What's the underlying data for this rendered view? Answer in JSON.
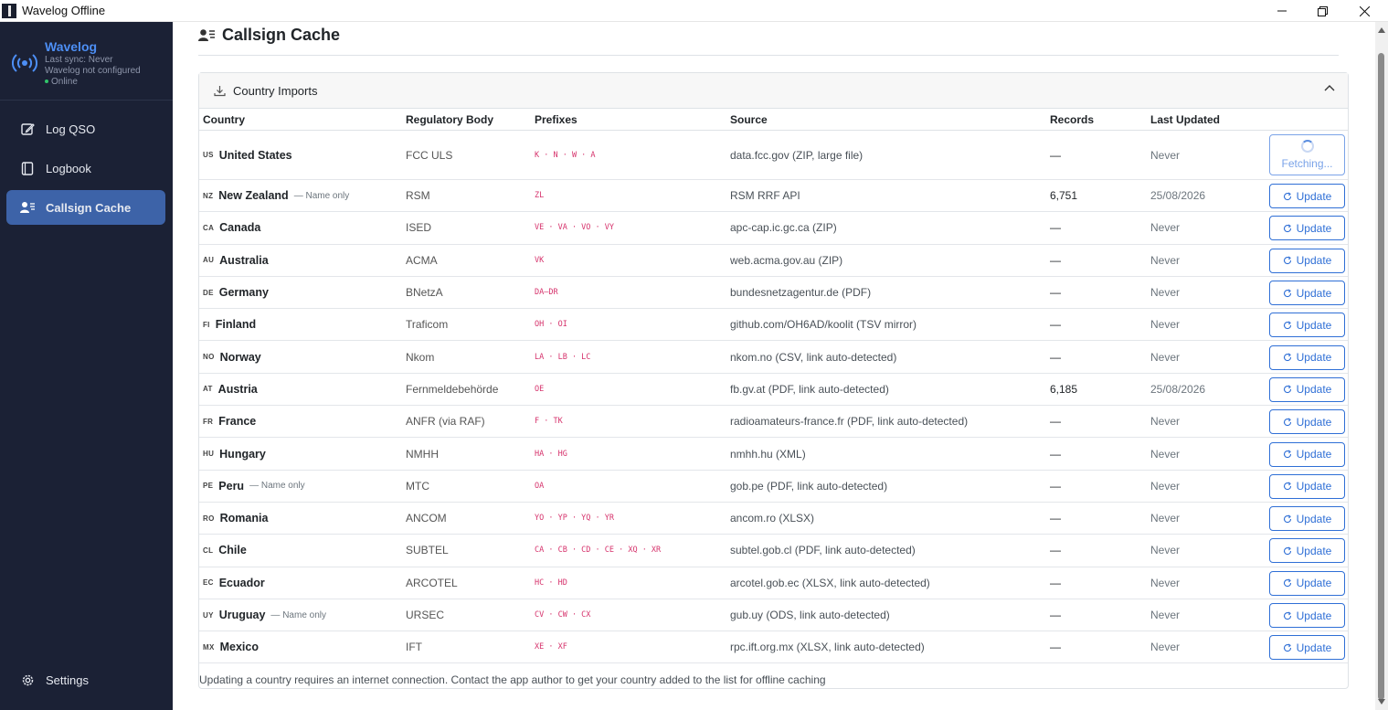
{
  "window": {
    "title": "Wavelog Offline",
    "minimize_icon": "minimize-icon",
    "restore_icon": "restore-icon",
    "close_icon": "close-icon"
  },
  "sidebar": {
    "brand_name": "Wavelog",
    "last_sync": "Last sync: Never",
    "config_status": "Wavelog not configured",
    "online_status": "Online",
    "items": [
      {
        "label": "Log QSO",
        "icon": "edit-icon"
      },
      {
        "label": "Logbook",
        "icon": "book-icon"
      },
      {
        "label": "Callsign Cache",
        "icon": "user-list-icon",
        "active": true
      }
    ],
    "settings_label": "Settings",
    "colors": {
      "background": "#1b2135",
      "brand": "#4d8ff5",
      "active": "#3d63a8",
      "online_dot": "#31c46a"
    }
  },
  "page": {
    "title": "Callsign Cache"
  },
  "card": {
    "header": "Country Imports",
    "columns": [
      "Country",
      "Regulatory Body",
      "Prefixes",
      "Source",
      "Records",
      "Last Updated"
    ],
    "update_label": "Update",
    "fetching_label": "Fetching...",
    "rows": [
      {
        "code": "US",
        "country": "United States",
        "note": "",
        "regulator": "FCC ULS",
        "prefixes": "K · N · W · A",
        "source": "data.fcc.gov (ZIP, large file)",
        "records": "—",
        "updated": "Never",
        "fetching": true
      },
      {
        "code": "NZ",
        "country": "New Zealand",
        "note": "— Name only",
        "regulator": "RSM",
        "prefixes": "ZL",
        "source": "RSM RRF API",
        "records": "6,751",
        "updated": "25/08/2026",
        "fetching": false
      },
      {
        "code": "CA",
        "country": "Canada",
        "note": "",
        "regulator": "ISED",
        "prefixes": "VE · VA · VO · VY",
        "source": "apc-cap.ic.gc.ca (ZIP)",
        "records": "—",
        "updated": "Never",
        "fetching": false
      },
      {
        "code": "AU",
        "country": "Australia",
        "note": "",
        "regulator": "ACMA",
        "prefixes": "VK",
        "source": "web.acma.gov.au (ZIP)",
        "records": "—",
        "updated": "Never",
        "fetching": false
      },
      {
        "code": "DE",
        "country": "Germany",
        "note": "",
        "regulator": "BNetzA",
        "prefixes": "DA–DR",
        "source": "bundesnetzagentur.de (PDF)",
        "records": "—",
        "updated": "Never",
        "fetching": false
      },
      {
        "code": "FI",
        "country": "Finland",
        "note": "",
        "regulator": "Traficom",
        "prefixes": "OH · OI",
        "source": "github.com/OH6AD/koolit (TSV mirror)",
        "records": "—",
        "updated": "Never",
        "fetching": false
      },
      {
        "code": "NO",
        "country": "Norway",
        "note": "",
        "regulator": "Nkom",
        "prefixes": "LA · LB · LC",
        "source": "nkom.no (CSV, link auto-detected)",
        "records": "—",
        "updated": "Never",
        "fetching": false
      },
      {
        "code": "AT",
        "country": "Austria",
        "note": "",
        "regulator": "Fernmeldebehörde",
        "prefixes": "OE",
        "source": "fb.gv.at (PDF, link auto-detected)",
        "records": "6,185",
        "updated": "25/08/2026",
        "fetching": false
      },
      {
        "code": "FR",
        "country": "France",
        "note": "",
        "regulator": "ANFR (via RAF)",
        "prefixes": "F · TK",
        "source": "radioamateurs-france.fr (PDF, link auto-detected)",
        "records": "—",
        "updated": "Never",
        "fetching": false
      },
      {
        "code": "HU",
        "country": "Hungary",
        "note": "",
        "regulator": "NMHH",
        "prefixes": "HA · HG",
        "source": "nmhh.hu (XML)",
        "records": "—",
        "updated": "Never",
        "fetching": false
      },
      {
        "code": "PE",
        "country": "Peru",
        "note": "— Name only",
        "regulator": "MTC",
        "prefixes": "OA",
        "source": "gob.pe (PDF, link auto-detected)",
        "records": "—",
        "updated": "Never",
        "fetching": false
      },
      {
        "code": "RO",
        "country": "Romania",
        "note": "",
        "regulator": "ANCOM",
        "prefixes": "YO · YP · YQ · YR",
        "source": "ancom.ro (XLSX)",
        "records": "—",
        "updated": "Never",
        "fetching": false
      },
      {
        "code": "CL",
        "country": "Chile",
        "note": "",
        "regulator": "SUBTEL",
        "prefixes": "CA · CB · CD · CE · XQ · XR",
        "source": "subtel.gob.cl (PDF, link auto-detected)",
        "records": "—",
        "updated": "Never",
        "fetching": false
      },
      {
        "code": "EC",
        "country": "Ecuador",
        "note": "",
        "regulator": "ARCOTEL",
        "prefixes": "HC · HD",
        "source": "arcotel.gob.ec (XLSX, link auto-detected)",
        "records": "—",
        "updated": "Never",
        "fetching": false
      },
      {
        "code": "UY",
        "country": "Uruguay",
        "note": "— Name only",
        "regulator": "URSEC",
        "prefixes": "CV · CW · CX",
        "source": "gub.uy (ODS, link auto-detected)",
        "records": "—",
        "updated": "Never",
        "fetching": false
      },
      {
        "code": "MX",
        "country": "Mexico",
        "note": "",
        "regulator": "IFT",
        "prefixes": "XE · XF",
        "source": "rpc.ift.org.mx (XLSX, link auto-detected)",
        "records": "—",
        "updated": "Never",
        "fetching": false
      }
    ],
    "footer_note": "Updating a country requires an internet connection. Contact the app author to get your country added to the list for offline caching",
    "colors": {
      "accent": "#2f6fd6",
      "prefix": "#d6336c"
    }
  }
}
